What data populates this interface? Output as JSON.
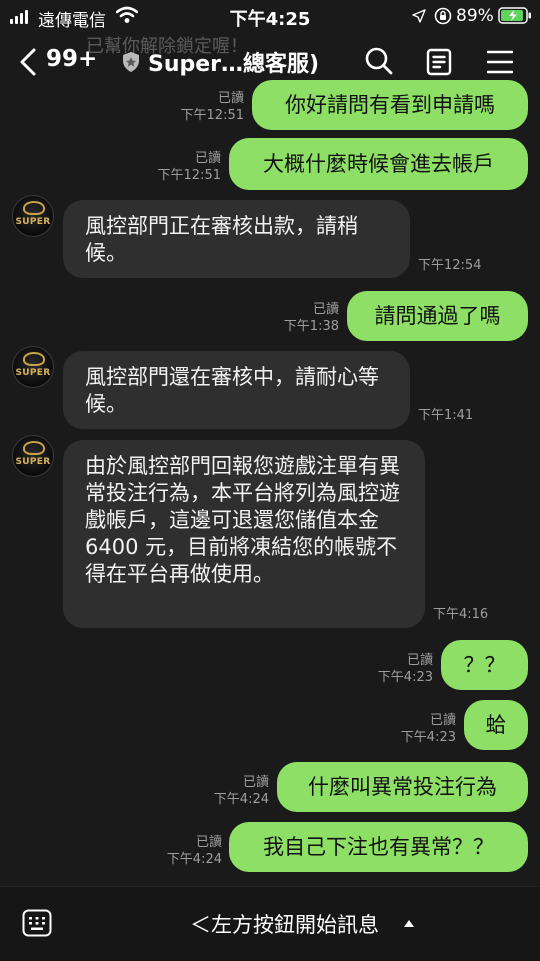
{
  "status": {
    "carrier": "遠傳電信",
    "time": "下午4:25",
    "battery": "89%",
    "icons": [
      "signal-bars-icon",
      "wifi-icon",
      "location-arrow-icon",
      "orientation-lock-icon",
      "battery-charging-icon"
    ]
  },
  "header": {
    "banner_ghost": "已幫你解除鎖定喔！",
    "back_count": "99+",
    "title": "Super…總客服)",
    "icons": [
      "back-chevron-icon",
      "shield-icon",
      "search-icon",
      "notes-icon",
      "menu-icon"
    ]
  },
  "messages": [
    {
      "dir": "out",
      "read": "已讀",
      "time": "下午12:51",
      "text": "你好請問有看到申請嗎"
    },
    {
      "dir": "out",
      "read": "已讀",
      "time": "下午12:51",
      "text": "大概什麼時候會進去帳戶"
    },
    {
      "dir": "in",
      "sender": "SUPER",
      "time": "下午12:54",
      "text": "風控部門正在審核出款，請稍候。"
    },
    {
      "dir": "out",
      "read": "已讀",
      "time": "下午1:38",
      "text": "請問通過了嗎"
    },
    {
      "dir": "in",
      "sender": "SUPER",
      "time": "下午1:41",
      "text": "風控部門還在審核中，請耐心等候。"
    },
    {
      "dir": "in",
      "sender": "SUPER",
      "time": "下午4:16",
      "text": "由於風控部門回報您遊戲注單有異常投注行為，本平台將列為風控遊戲帳戶，這邊可退還您儲值本金 6400 元，目前將凍結您的帳號不得在平台再做使用。"
    },
    {
      "dir": "out",
      "read": "已讀",
      "time": "下午4:23",
      "text": "？？"
    },
    {
      "dir": "out",
      "read": "已讀",
      "time": "下午4:23",
      "text": "蛤"
    },
    {
      "dir": "out",
      "read": "已讀",
      "time": "下午4:24",
      "text": "什麼叫異常投注行為"
    },
    {
      "dir": "out",
      "read": "已讀",
      "time": "下午4:24",
      "text": "我自己下注也有異常？？"
    }
  ],
  "bottom": {
    "label": "＜左方按鈕開始訊息",
    "icons": [
      "keyboard-icon",
      "caret-up-icon"
    ]
  },
  "colors": {
    "background": "#1a1a1a",
    "outgoing_bubble": "#8de065",
    "incoming_bubble": "#2f2f2f",
    "meta_text": "#9e9e9e"
  }
}
